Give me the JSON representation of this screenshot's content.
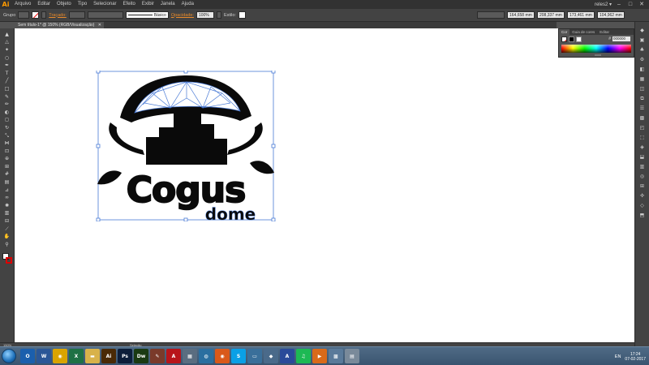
{
  "menubar": {
    "logo": "Ai",
    "items": [
      "Arquivo",
      "Editar",
      "Objeto",
      "Tipo",
      "Selecionar",
      "Efeito",
      "Exibir",
      "Janela",
      "Ajuda"
    ],
    "workspace": "reles2 ▾",
    "window_controls": [
      "–",
      "□",
      "✕"
    ]
  },
  "controlbar": {
    "selection_label": "Grupo",
    "stroke_label": "Traçado:",
    "brush_label": "Básico",
    "opacity_label": "Opacidade:",
    "opacity_value": "100%",
    "style_label": "Estilo:",
    "x_value": "164,658 mm",
    "y_value": "208,337 mm",
    "w_value": "173,461 mm",
    "h_value": "104,962 mm"
  },
  "document": {
    "tab_title": "Sem título-1* @ 150% (RGB/Visualização)",
    "close_glyph": "✕"
  },
  "artwork": {
    "word_main": "Cogus",
    "word_sub": "dome"
  },
  "color_panel": {
    "tabs": [
      "Cor",
      "Guia de cores",
      "Editar"
    ],
    "hex_prefix": "#",
    "hex_value": "000000"
  },
  "statusbar": {
    "zoom": "150%",
    "mode": "Seleção"
  },
  "toolbar": {
    "tools": [
      {
        "name": "selection-tool",
        "glyph": "▲"
      },
      {
        "name": "direct-selection-tool",
        "glyph": "△"
      },
      {
        "name": "magic-wand-tool",
        "glyph": "✦"
      },
      {
        "name": "lasso-tool",
        "glyph": "○"
      },
      {
        "name": "pen-tool",
        "glyph": "✒"
      },
      {
        "name": "type-tool",
        "glyph": "T"
      },
      {
        "name": "line-tool",
        "glyph": "╱"
      },
      {
        "name": "rectangle-tool",
        "glyph": "□"
      },
      {
        "name": "paintbrush-tool",
        "glyph": "✎"
      },
      {
        "name": "pencil-tool",
        "glyph": "✏"
      },
      {
        "name": "blob-brush-tool",
        "glyph": "◐"
      },
      {
        "name": "eraser-tool",
        "glyph": "◻"
      },
      {
        "name": "rotate-tool",
        "glyph": "↻"
      },
      {
        "name": "scale-tool",
        "glyph": "⤡"
      },
      {
        "name": "width-tool",
        "glyph": "⋈"
      },
      {
        "name": "free-transform-tool",
        "glyph": "⊡"
      },
      {
        "name": "shape-builder-tool",
        "glyph": "⊕"
      },
      {
        "name": "perspective-grid-tool",
        "glyph": "⊞"
      },
      {
        "name": "mesh-tool",
        "glyph": "#"
      },
      {
        "name": "gradient-tool",
        "glyph": "▤"
      },
      {
        "name": "eyedropper-tool",
        "glyph": "⊿"
      },
      {
        "name": "blend-tool",
        "glyph": "∞"
      },
      {
        "name": "symbol-sprayer-tool",
        "glyph": "✺"
      },
      {
        "name": "column-graph-tool",
        "glyph": "▥"
      },
      {
        "name": "artboard-tool",
        "glyph": "⊟"
      },
      {
        "name": "slice-tool",
        "glyph": "⟋"
      },
      {
        "name": "hand-tool",
        "glyph": "✋"
      },
      {
        "name": "zoom-tool",
        "glyph": "⚲"
      }
    ]
  },
  "dock": {
    "icons": [
      "◆",
      "▣",
      "♣",
      "⚙",
      "◧",
      "▦",
      "◫",
      "⧉",
      "☰",
      "▩",
      "◰",
      "⬚",
      "◈",
      "⬓",
      "▥",
      "◎",
      "⊞",
      "✣",
      "◇",
      "⬒"
    ]
  },
  "taskbar": {
    "apps": [
      {
        "name": "outlook",
        "label": "O",
        "color": "#1b5fad"
      },
      {
        "name": "word",
        "label": "W",
        "color": "#2b5797"
      },
      {
        "name": "chrome",
        "label": "◉",
        "color": "#d9a400"
      },
      {
        "name": "excel",
        "label": "X",
        "color": "#1e7145"
      },
      {
        "name": "file-explorer",
        "label": "▬",
        "color": "#d8b24a"
      },
      {
        "name": "illustrator",
        "label": "Ai",
        "color": "#4a2a06"
      },
      {
        "name": "photoshop",
        "label": "Ps",
        "color": "#0d1e3a"
      },
      {
        "name": "dreamweaver",
        "label": "Dw",
        "color": "#1a3a12"
      },
      {
        "name": "paint-tool",
        "label": "✎",
        "color": "#7a3a2a"
      },
      {
        "name": "acrobat",
        "label": "A",
        "color": "#b8141a"
      },
      {
        "name": "calculator",
        "label": "▦",
        "color": "#5a6d80"
      },
      {
        "name": "network",
        "label": "◍",
        "color": "#2a6fa0"
      },
      {
        "name": "firefox",
        "label": "◉",
        "color": "#d9591a"
      },
      {
        "name": "skype",
        "label": "S",
        "color": "#0aa0e6"
      },
      {
        "name": "screen-tool",
        "label": "▭",
        "color": "#3a6f9a"
      },
      {
        "name": "app-generic",
        "label": "◆",
        "color": "#4a6a8a"
      },
      {
        "name": "inkscape",
        "label": "A",
        "color": "#2a4a9a"
      },
      {
        "name": "spotify",
        "label": "♫",
        "color": "#1db954"
      },
      {
        "name": "media-player",
        "label": "▶",
        "color": "#d96a1a"
      },
      {
        "name": "photos",
        "label": "▩",
        "color": "#5a7a9a"
      },
      {
        "name": "notepad",
        "label": "▤",
        "color": "#7a8a9a"
      }
    ],
    "language": "EN",
    "time": "17:24",
    "date": "07-02-2017"
  },
  "colors": {
    "artboard_selection": "#4a7bd6",
    "accent_orange": "#e88a2a"
  }
}
